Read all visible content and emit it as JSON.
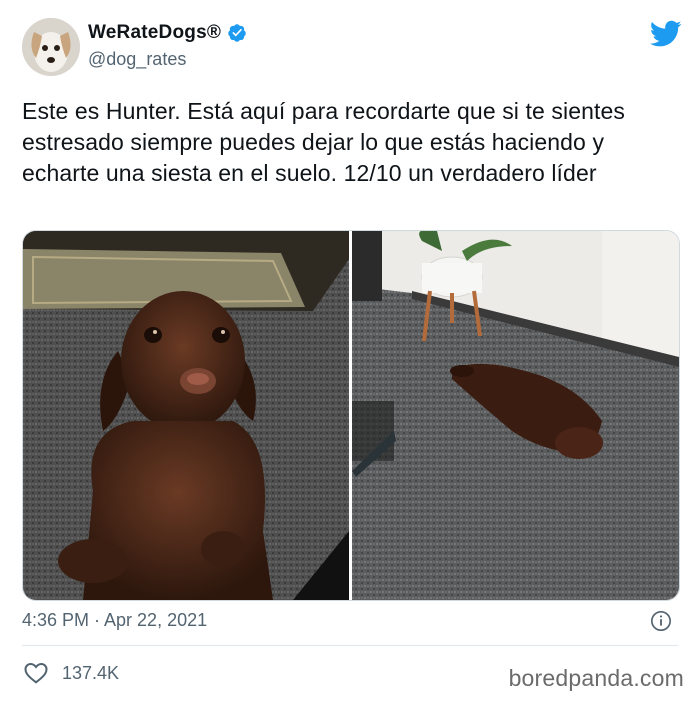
{
  "account": {
    "display_name": "WeRateDogs®",
    "handle": "@dog_rates",
    "verified": true,
    "avatar": "dog-avatar"
  },
  "tweet": {
    "text": "Este es Hunter. Está aquí para recordarte que si te sientes estresado siempre puedes dejar lo que estás haciendo y echarte una siesta en el suelo. 12/10 un verdadero líder",
    "timestamp": "4:36 PM · Apr 22, 2021",
    "likes": "137.4K"
  },
  "media": {
    "photos": [
      "puppy-sitting-on-carpet",
      "puppy-lying-on-floor"
    ]
  },
  "icons": {
    "brand": "twitter-bird-icon",
    "verified": "verified-badge-icon",
    "info": "info-icon",
    "like": "heart-icon"
  },
  "watermark": "boredpanda.com",
  "colors": {
    "twitter_blue": "#1d9bf0",
    "text_primary": "#0f1419",
    "text_secondary": "#536471",
    "puppy_brown": "#4a2a1c"
  }
}
